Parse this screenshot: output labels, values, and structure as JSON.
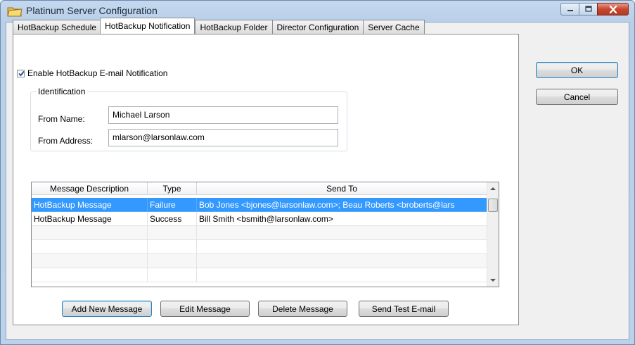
{
  "window": {
    "title": "Platinum Server Configuration"
  },
  "tabs": [
    {
      "label": "HotBackup Schedule"
    },
    {
      "label": "HotBackup Notification"
    },
    {
      "label": "HotBackup Folder"
    },
    {
      "label": "Director Configuration"
    },
    {
      "label": "Server Cache"
    }
  ],
  "active_tab": "HotBackup Notification",
  "notification": {
    "enable_label": "Enable HotBackup E-mail Notification",
    "enabled": true,
    "group_title": "Identification",
    "from_name_label": "From Name:",
    "from_name_value": "Michael Larson",
    "from_address_label": "From Address:",
    "from_address_value": "mlarson@larsonlaw.com"
  },
  "messages": {
    "columns": [
      "Message Description",
      "Type",
      "Send To"
    ],
    "rows": [
      {
        "description": "HotBackup Message",
        "type": "Failure",
        "send_to": "Bob Jones <bjones@larsonlaw.com>; Beau Roberts <broberts@lars",
        "selected": true
      },
      {
        "description": "HotBackup Message",
        "type": "Success",
        "send_to": "Bill Smith <bsmith@larsonlaw.com>",
        "selected": false
      }
    ]
  },
  "buttons": {
    "ok": "OK",
    "cancel": "Cancel",
    "add_new_message": "Add New Message",
    "edit_message": "Edit Message",
    "delete_message": "Delete Message",
    "send_test_email": "Send Test E-mail"
  },
  "icons": {
    "app": "folder-icon",
    "minimize": "minimize-icon",
    "maximize": "maximize-icon",
    "close": "close-icon"
  }
}
